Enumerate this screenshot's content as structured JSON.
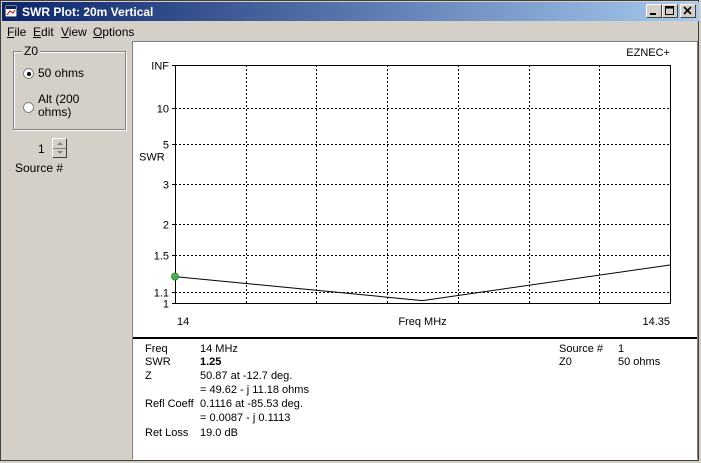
{
  "window": {
    "title": "SWR Plot: 20m Vertical"
  },
  "menu": [
    {
      "label": "File",
      "accel": "F",
      "rest": "ile"
    },
    {
      "label": "Edit",
      "accel": "E",
      "rest": "dit"
    },
    {
      "label": "View",
      "accel": "V",
      "rest": "iew"
    },
    {
      "label": "Options",
      "accel": "O",
      "rest": "ptions"
    }
  ],
  "z0_group": {
    "legend": "Z0",
    "option1": "50 ohms",
    "option2_line1": "Alt (200",
    "option2_line2": "ohms)",
    "selected": "option1"
  },
  "source": {
    "value": "1",
    "label": "Source #"
  },
  "chart_data": {
    "type": "line",
    "brand": "EZNEC+",
    "ylabel": "SWR",
    "xlabel": "Freq MHz",
    "x_range": [
      14,
      14.35
    ],
    "x_tick_labels": [
      "14",
      "14.35"
    ],
    "y_scale": "swr-reflection",
    "y_ticks": [
      "INF",
      "10",
      "5",
      "3",
      "2",
      "1.5",
      "1.1",
      "1"
    ],
    "grid": true,
    "series": [
      {
        "x": [
          14.0,
          14.175,
          14.35
        ],
        "y": [
          1.25,
          1.02,
          1.38
        ]
      }
    ],
    "marker": {
      "x": 14.0,
      "y": 1.25,
      "color": "#4caf50"
    },
    "line_color": "#000000"
  },
  "info": {
    "freq_label": "Freq",
    "freq_value": "14 MHz",
    "swr_label": "SWR",
    "swr_value": "1.25",
    "z_label": "Z",
    "z_line1": "50.87 at -12.7 deg.",
    "z_line2": "= 49.62 - j 11.18 ohms",
    "refl_label": "Refl Coeff",
    "refl_line1": "0.1116 at -85.53 deg.",
    "refl_line2": "= 0.0087 - j 0.1113",
    "retloss_label": "Ret Loss",
    "retloss_value": "19.0 dB",
    "source_label": "Source #",
    "source_value": "1",
    "z0_label": "Z0",
    "z0_value": "50 ohms"
  }
}
